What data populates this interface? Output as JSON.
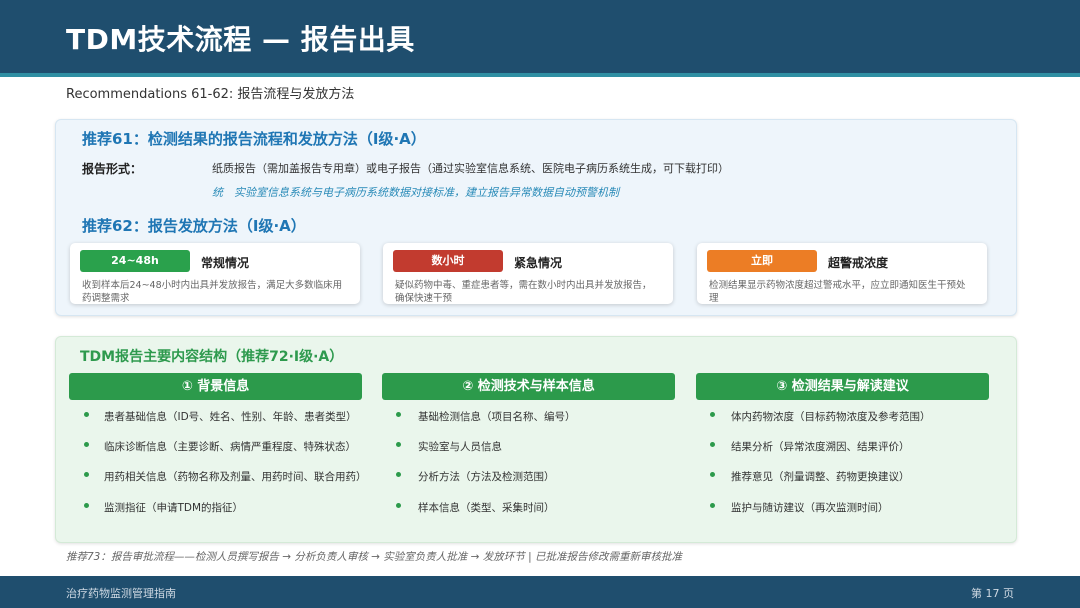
{
  "header": {
    "title": "TDM技术流程 — 报告出具"
  },
  "subtitle": "Recommendations 61-62: 报告流程与发放方法",
  "rec61": {
    "title": "推荐61：检测结果的报告流程和发放方法（Ⅰ级·A）",
    "report_label": "报告形式：",
    "report_value": "纸质报告（需加盖报告专用章）或电子报告（通过实验室信息系统、医院电子病历系统生成，可下载打印）",
    "note": "统　实验室信息系统与电子病历系统数据对接标准，建立报告异常数据自动预警机制"
  },
  "rec62": {
    "title": "推荐62：报告发放方法（Ⅰ级·A）",
    "cards": [
      {
        "pill": "24~48h",
        "label": "常规情况",
        "desc": "收到样本后24~48小时内出具并发放报告，满足大多数临床用药调整需求",
        "color": "#2aa14c"
      },
      {
        "pill": "数小时",
        "label": "紧急情况",
        "desc": "疑似药物中毒、重症患者等，需在数小时内出具并发放报告，确保快速干预",
        "color": "#c23b2f"
      },
      {
        "pill": "立即",
        "label": "超警戒浓度",
        "desc": "检测结果显示药物浓度超过警戒水平，应立即通知医生干预处理",
        "color": "#ec7d25"
      }
    ]
  },
  "tdm": {
    "title": "TDM报告主要内容结构（推荐72·Ⅰ级·A）",
    "columns": [
      {
        "head": "① 背景信息",
        "items": [
          "患者基础信息（ID号、姓名、性别、年龄、患者类型）",
          "临床诊断信息（主要诊断、病情严重程度、特殊状态）",
          "用药相关信息（药物名称及剂量、用药时间、联合用药）",
          "监测指征（申请TDM的指征）"
        ]
      },
      {
        "head": "② 检测技术与样本信息",
        "items": [
          "基础检测信息（项目名称、编号）",
          "实验室与人员信息",
          "分析方法（方法及检测范围）",
          "样本信息（类型、采集时间）"
        ]
      },
      {
        "head": "③ 检测结果与解读建议",
        "items": [
          "体内药物浓度（目标药物浓度及参考范围）",
          "结果分析（异常浓度溯因、结果评价）",
          "推荐意见（剂量调整、药物更换建议）",
          "监护与随访建议（再次监测时间）"
        ]
      }
    ]
  },
  "footer_note": "推荐73：报告审批流程——检测人员撰写报告 → 分析负责人审核 → 实验室负责人批准 → 发放环节 | 已批准报告修改需重新审核批准",
  "footer": {
    "left": "治疗药物监测管理指南",
    "right": "第 17 页"
  }
}
